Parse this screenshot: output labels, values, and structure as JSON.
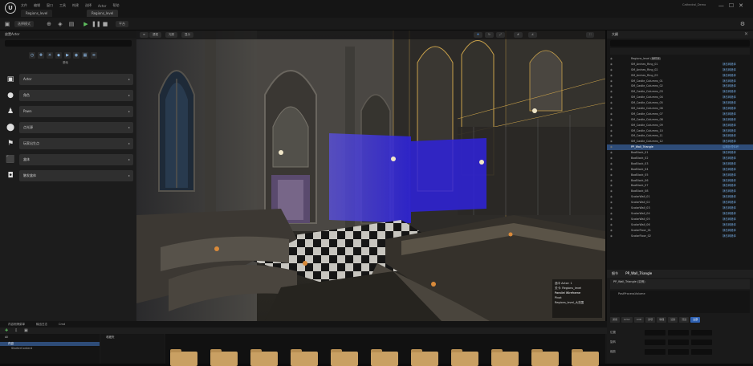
{
  "app": {
    "logo": "U",
    "menu": [
      "文件",
      "编辑",
      "窗口",
      "工具",
      "构建",
      "选择",
      "Actor",
      "帮助"
    ],
    "tab_title": "Regions_level",
    "right_title": "Cathedral_Demo",
    "window_controls": "—☐✕"
  },
  "toolbar": {
    "save_label": "保存",
    "mode_label": "选择模式",
    "platform_label": "平台"
  },
  "left_panel": {
    "title": "放置Actor",
    "mode_label": "基础",
    "categories": [
      {
        "label": "Actor",
        "icon": "cube-icon"
      },
      {
        "label": "角色",
        "icon": "character-icon"
      },
      {
        "label": "Pawn",
        "icon": "pawn-icon"
      },
      {
        "label": "点光源",
        "icon": "light-icon"
      },
      {
        "label": "玩家出生点",
        "icon": "player-start-icon"
      },
      {
        "label": "盒体",
        "icon": "box-icon"
      },
      {
        "label": "触发盒体",
        "icon": "trigger-icon"
      }
    ]
  },
  "viewport": {
    "tools": [
      "透视",
      "光照",
      "显示"
    ],
    "info": [
      "选中 Actor: 1",
      "关卡: Regions_level",
      "Parallel Wireframe",
      "Pivot",
      "Regions_level_大范围"
    ]
  },
  "outliner": {
    "title": "大纲",
    "rows": [
      {
        "name": "Regions_level (编辑器)",
        "type": ""
      },
      {
        "name": "SM_Arches_Ring_01",
        "type": "静态网格体"
      },
      {
        "name": "SM_Arches_Ring_02",
        "type": "静态网格体"
      },
      {
        "name": "SM_Arches_Ring_03",
        "type": "静态网格体"
      },
      {
        "name": "SM_Castle_Columns_01",
        "type": "静态网格体"
      },
      {
        "name": "SM_Castle_Columns_02",
        "type": "静态网格体"
      },
      {
        "name": "SM_Castle_Columns_03",
        "type": "静态网格体"
      },
      {
        "name": "SM_Castle_Columns_04",
        "type": "静态网格体"
      },
      {
        "name": "SM_Castle_Columns_05",
        "type": "静态网格体"
      },
      {
        "name": "SM_Castle_Columns_06",
        "type": "静态网格体"
      },
      {
        "name": "SM_Castle_Columns_07",
        "type": "静态网格体"
      },
      {
        "name": "SM_Castle_Columns_08",
        "type": "静态网格体"
      },
      {
        "name": "SM_Castle_Columns_09",
        "type": "静态网格体"
      },
      {
        "name": "SM_Castle_Columns_10",
        "type": "静态网格体"
      },
      {
        "name": "SM_Castle_Columns_11",
        "type": "静态网格体"
      },
      {
        "name": "SM_Castle_Columns_12",
        "type": "静态网格体"
      },
      {
        "name": "PP_Wall_Triangle",
        "type": "后期处理体积"
      },
      {
        "name": "BoxBlock_01",
        "type": "静态网格体"
      },
      {
        "name": "BoxBlock_02",
        "type": "静态网格体"
      },
      {
        "name": "BoxBlock_03",
        "type": "静态网格体"
      },
      {
        "name": "BoxBlock_04",
        "type": "静态网格体"
      },
      {
        "name": "BoxBlock_05",
        "type": "静态网格体"
      },
      {
        "name": "BoxBlock_06",
        "type": "静态网格体"
      },
      {
        "name": "BoxBlock_07",
        "type": "静态网格体"
      },
      {
        "name": "BoxBlock_08",
        "type": "静态网格体"
      },
      {
        "name": "ScalarWall_01",
        "type": "静态网格体"
      },
      {
        "name": "ScalarWall_02",
        "type": "静态网格体"
      },
      {
        "name": "ScalarWall_03",
        "type": "静态网格体"
      },
      {
        "name": "ScalarWall_04",
        "type": "静态网格体"
      },
      {
        "name": "ScalarWall_05",
        "type": "静态网格体"
      },
      {
        "name": "ScalarWall_06",
        "type": "静态网格体"
      },
      {
        "name": "ScalarFloor_01",
        "type": "静态网格体"
      },
      {
        "name": "ScalarFloor_02",
        "type": "静态网格体"
      }
    ],
    "selected_index": 16
  },
  "details": {
    "title": "细节",
    "actor_name": "PP_Wall_Triangle",
    "component_root": "PP_Wall_Triangle (实例)",
    "component_child": "PostProcessVolume",
    "tabs": [
      "通用",
      "Actor",
      "LOD",
      "杂项",
      "物理",
      "渲染",
      "流送",
      "全部"
    ],
    "properties": [
      {
        "label": "位置"
      },
      {
        "label": "旋转"
      },
      {
        "label": "缩放"
      }
    ]
  },
  "bottom": {
    "tabs": [
      "内容侧滑菜单",
      "输出日志",
      "Cmd"
    ],
    "folder_root": "All",
    "folders": [
      "内容",
      "Content",
      "StarterContent"
    ],
    "filters_label": "收藏夹"
  },
  "colors": {
    "accent": "#2f62b3",
    "selection": "#2e4c78",
    "volume": "#3c30e0"
  }
}
